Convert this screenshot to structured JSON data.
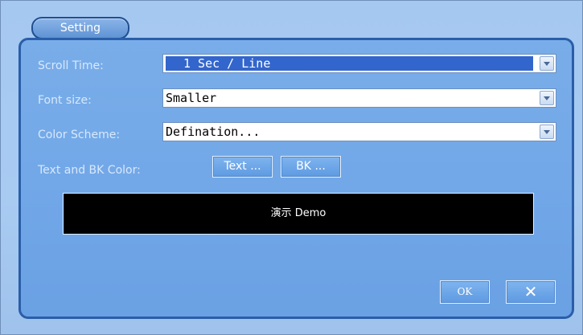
{
  "window": {
    "title": "Setting"
  },
  "fields": {
    "scroll_time": {
      "label": "Scroll Time:",
      "value": "1 Sec / Line"
    },
    "font_size": {
      "label": "Font size:",
      "value": "Smaller"
    },
    "color_scheme": {
      "label": "Color Scheme:",
      "value": "Defination..."
    },
    "text_bk_color": {
      "label": "Text and BK Color:",
      "text_button": "Text ...",
      "bk_button": "BK ..."
    }
  },
  "preview": {
    "text": "演示 Demo",
    "background": "#000000",
    "color": "#ffffff"
  },
  "buttons": {
    "ok": "OK",
    "close": "✕"
  },
  "colors": {
    "panel": "#72a8e8",
    "border": "#2a5ea8",
    "selection": "#3366cc"
  },
  "icons": {
    "dropdown": "chevron-down-icon",
    "close": "close-icon"
  }
}
